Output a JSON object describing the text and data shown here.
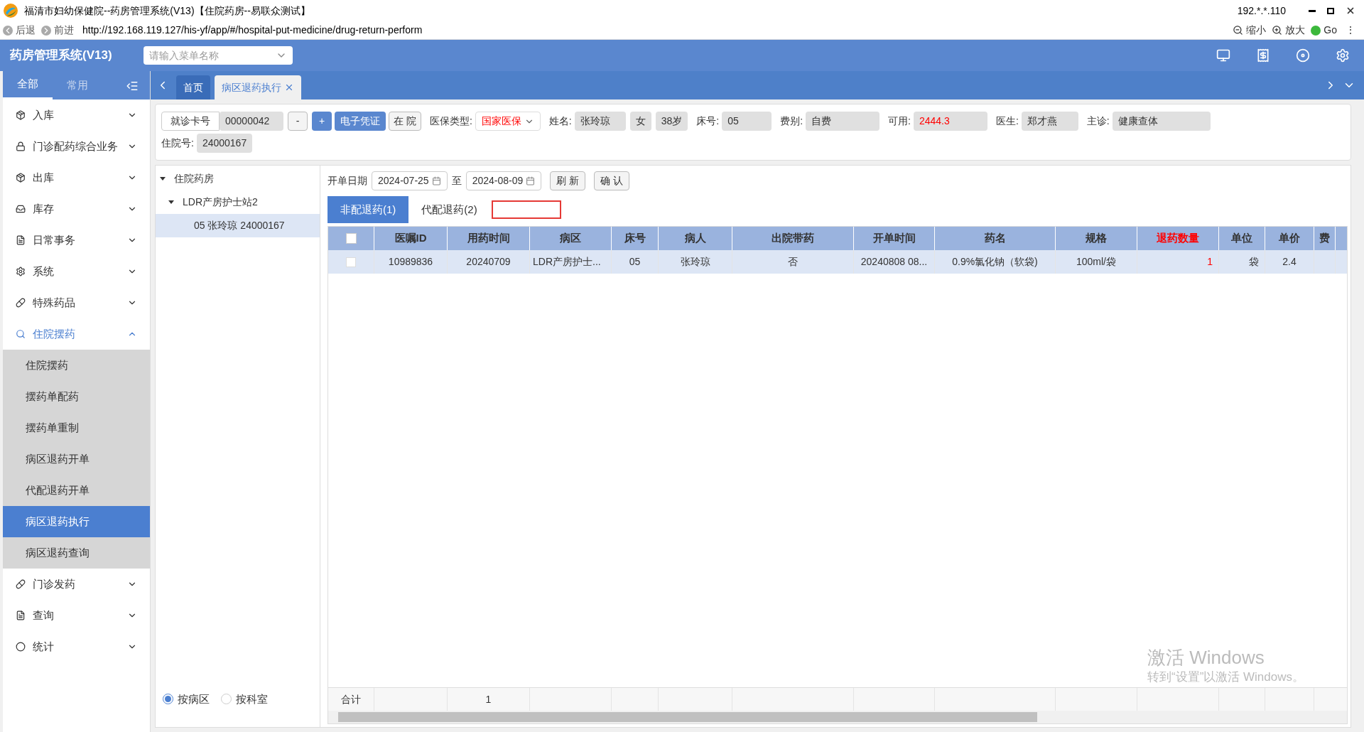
{
  "window": {
    "title": "福清市妇幼保健院--药房管理系统(V13)【住院药房--易联众测试】",
    "ip": "192.*.*.110"
  },
  "browser": {
    "back": "后退",
    "forward": "前进",
    "url": "http://192.168.119.127/his-yf/app/#/hospital-put-medicine/drug-return-perform",
    "zoom_out": "缩小",
    "zoom_in": "放大",
    "go": "Go",
    "more": "⋮"
  },
  "header": {
    "app_title": "药房管理系统(V13)",
    "menu_search": {
      "placeholder": "请输入菜单名称"
    }
  },
  "sidebar": {
    "tabs": [
      {
        "label": "全部",
        "selected": true
      },
      {
        "label": "常用",
        "selected": false
      }
    ],
    "items": [
      {
        "label": "入库",
        "kind": "box",
        "expanded": false
      },
      {
        "label": "门诊配药综合业务",
        "kind": "lock",
        "expanded": false
      },
      {
        "label": "出库",
        "kind": "box",
        "expanded": false
      },
      {
        "label": "库存",
        "kind": "tray",
        "expanded": false
      },
      {
        "label": "日常事务",
        "kind": "doc",
        "expanded": false
      },
      {
        "label": "系统",
        "kind": "gear",
        "expanded": false
      },
      {
        "label": "特殊药品",
        "kind": "bottle",
        "expanded": false
      },
      {
        "label": "住院摆药",
        "kind": "search",
        "expanded": true,
        "children": [
          {
            "label": "住院摆药",
            "selected": false
          },
          {
            "label": "摆药单配药",
            "selected": false
          },
          {
            "label": "摆药单重制",
            "selected": false
          },
          {
            "label": "病区退药开单",
            "selected": false
          },
          {
            "label": "代配退药开单",
            "selected": false
          },
          {
            "label": "病区退药执行",
            "selected": true
          },
          {
            "label": "病区退药查询",
            "selected": false
          }
        ]
      },
      {
        "label": "门诊发药",
        "kind": "bottle",
        "expanded": false
      },
      {
        "label": "查询",
        "kind": "doc",
        "expanded": false
      },
      {
        "label": "统计",
        "kind": "circle",
        "expanded": false
      }
    ]
  },
  "page_tabs": [
    {
      "label": "首页",
      "selected": false,
      "closable": false
    },
    {
      "label": "病区退药执行",
      "selected": true,
      "closable": true
    }
  ],
  "patient": {
    "card_label": "就诊卡号",
    "card_no": "00000042",
    "minus": "-",
    "plus": "+",
    "e_cert": "电子凭证",
    "in_hospital": "在 院",
    "insurance_label": "医保类型:",
    "insurance": "国家医保",
    "name_label": "姓名:",
    "name": "张玲琼",
    "sex": "女",
    "age": "38岁",
    "bed_label": "床号:",
    "bed": "05",
    "fee_label": "费别:",
    "fee": "自费",
    "avail_label": "可用:",
    "avail": "2444.3",
    "doctor_label": "医生:",
    "doctor": "郑才燕",
    "diag_label": "主诊:",
    "diag": "健康查体",
    "inpatient_label": "住院号:",
    "inpatient_no": "24000167"
  },
  "tree": {
    "items": [
      {
        "label": "住院药房",
        "expanded": true,
        "children": [
          {
            "label": "LDR产房护士站2",
            "expanded": true,
            "children": [
              {
                "label": "05 张玲琼 24000167",
                "selected": true
              }
            ]
          }
        ]
      }
    ],
    "radios": [
      {
        "label": "按病区",
        "selected": true
      },
      {
        "label": "按科室",
        "selected": false
      }
    ]
  },
  "filter": {
    "date_label": "开单日期",
    "from": "2024-07-25",
    "to_label": "至",
    "to": "2024-08-09",
    "refresh": "刷 新",
    "confirm": "确 认"
  },
  "sub_tabs": [
    {
      "label": "非配退药(1)",
      "selected": true
    },
    {
      "label": "代配退药(2)",
      "selected": false
    }
  ],
  "table": {
    "all_checked": false,
    "columns": [
      {
        "label": "医嘱ID",
        "highlight": false
      },
      {
        "label": "用药时间",
        "highlight": false
      },
      {
        "label": "病区",
        "highlight": false
      },
      {
        "label": "床号",
        "highlight": false
      },
      {
        "label": "病人",
        "highlight": false
      },
      {
        "label": "出院带药",
        "highlight": false
      },
      {
        "label": "开单时间",
        "highlight": false
      },
      {
        "label": "药名",
        "highlight": false
      },
      {
        "label": "规格",
        "highlight": false
      },
      {
        "label": "退药数量",
        "highlight": true
      },
      {
        "label": "单位",
        "highlight": false
      },
      {
        "label": "单价",
        "highlight": false
      },
      {
        "label": "费",
        "highlight": false
      }
    ],
    "rows": [
      {
        "checked": false,
        "cells": [
          "10989836",
          "20240709",
          "LDR产房护士...",
          "05",
          "张玲琼",
          "否",
          "20240808 08...",
          "0.9%氯化钠（软袋)",
          "100ml/袋",
          "1",
          "袋",
          "2.4",
          ""
        ]
      }
    ],
    "footer": {
      "label": "合计",
      "cells": [
        "",
        "1",
        "",
        "",
        "",
        "",
        "",
        "",
        "",
        "",
        "",
        ""
      ]
    }
  },
  "watermark": {
    "title": "激活 Windows",
    "hint": "转到“设置”以激活 Windows。"
  }
}
